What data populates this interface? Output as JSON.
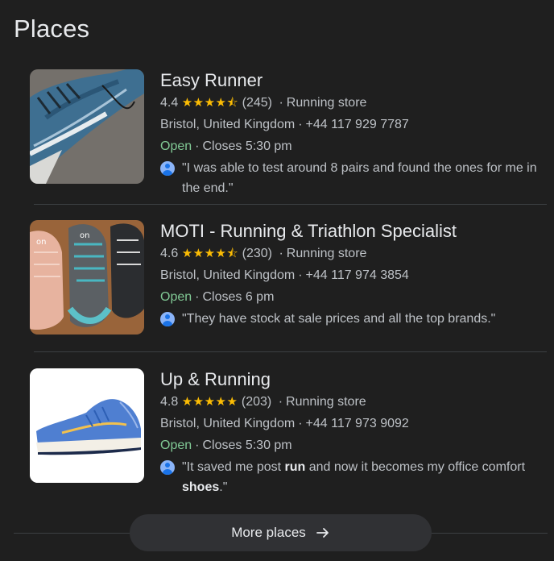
{
  "section_title": "Places",
  "places": [
    {
      "name": "Easy Runner",
      "rating": "4.4",
      "stars": "★★★★⯪",
      "reviews": "(245)",
      "category": "Running store",
      "location": "Bristol, United Kingdom",
      "phone": "+44 117 929 7787",
      "status": "Open",
      "hours": "Closes 5:30 pm",
      "review_parts": [
        "\"I was able to test around 8 pairs and found the ones for me in the end.\""
      ]
    },
    {
      "name": "MOTI - Running & Triathlon Specialist",
      "rating": "4.6",
      "stars": "★★★★⯪",
      "reviews": "(230)",
      "category": "Running store",
      "location": "Bristol, United Kingdom",
      "phone": "+44 117 974 3854",
      "status": "Open",
      "hours": "Closes 6 pm",
      "review_parts": [
        "\"They have stock at sale prices and all the top brands.\""
      ]
    },
    {
      "name": "Up & Running",
      "rating": "4.8",
      "stars": "★★★★★",
      "reviews": "(203)",
      "category": "Running store",
      "location": "Bristol, United Kingdom",
      "phone": "+44 117 973 9092",
      "status": "Open",
      "hours": "Closes 5:30 pm",
      "review_parts": [
        "\"It saved me post ",
        "run",
        " and now it becomes my office comfort ",
        "shoes",
        ".\""
      ]
    }
  ],
  "more_button": {
    "label": "More places"
  },
  "colors": {
    "open": "#81c995",
    "stars": "#fbbc04",
    "button_bg": "#303134"
  }
}
